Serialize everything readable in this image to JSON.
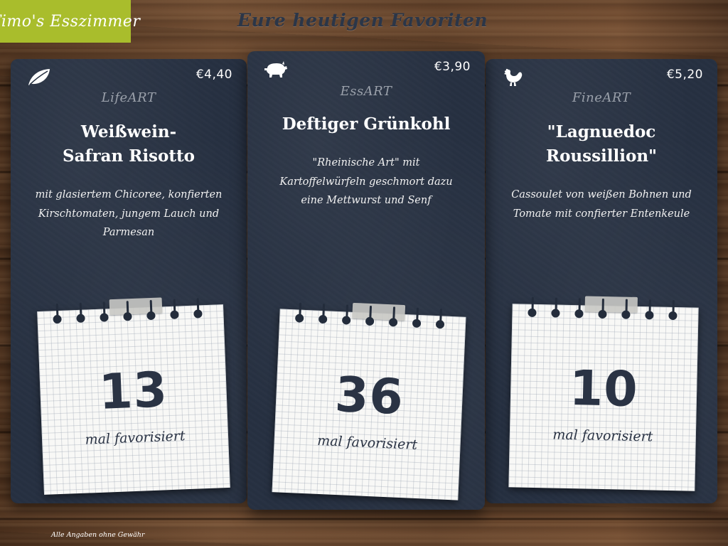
{
  "logo": {
    "text": "Timo's Esszimmer"
  },
  "header": {
    "title": "Eure heutigen Favoriten"
  },
  "cards": [
    {
      "icon": "leaf-icon",
      "price": "€4,40",
      "category": "LifeART",
      "title_lines": [
        "Weißwein-",
        "Safran Risotto"
      ],
      "description_lines": [
        "mit glasiertem Chicoree, konfierten",
        "Kirschtomaten, jungem Lauch und",
        "Parmesan"
      ],
      "count": "13",
      "count_label": "mal favorisiert"
    },
    {
      "icon": "pig-icon",
      "price": "€3,90",
      "category": "EssART",
      "title_lines": [
        "Deftiger Grünkohl"
      ],
      "description_lines": [
        "\"Rheinische Art\" mit",
        "Kartoffelwürfeln geschmort dazu",
        "eine Mettwurst und Senf"
      ],
      "count": "36",
      "count_label": "mal favorisiert"
    },
    {
      "icon": "chicken-icon",
      "price": "€5,20",
      "category": "FineART",
      "title_lines": [
        "\"Lagnuedoc",
        "Roussillion\""
      ],
      "description_lines": [
        "Cassoulet von weißen Bohnen und",
        "Tomate mit confierter Entenkeule"
      ],
      "count": "10",
      "count_label": "mal favorisiert"
    }
  ],
  "footer": {
    "disclaimer": "Alle Angaben ohne Gewähr"
  },
  "colors": {
    "logo_bg": "#a9bd2c",
    "card_bg": "#263041",
    "title_text": "#2b3648",
    "category_text": "#9aa0aa"
  }
}
